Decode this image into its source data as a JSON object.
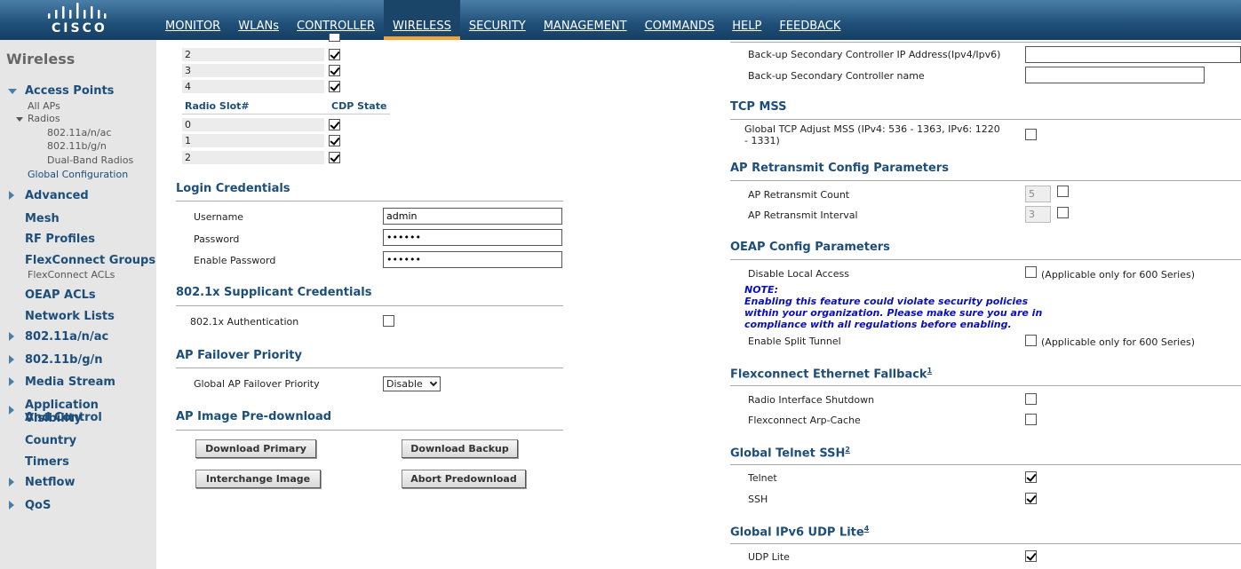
{
  "brand": {
    "logo_text": "CISCO"
  },
  "nav": [
    {
      "label": "MONITOR"
    },
    {
      "label": "WLANs"
    },
    {
      "label": "CONTROLLER"
    },
    {
      "label": "WIRELESS"
    },
    {
      "label": "SECURITY"
    },
    {
      "label": "MANAGEMENT"
    },
    {
      "label": "COMMANDS"
    },
    {
      "label": "HELP"
    },
    {
      "label": "FEEDBACK"
    }
  ],
  "sidebar": {
    "title": "Wireless",
    "access_points": "Access Points",
    "all_aps": "All APs",
    "radios": "Radios",
    "radio_a": "802.11a/n/ac",
    "radio_b": "802.11b/g/n",
    "dual_band": "Dual-Band Radios",
    "global_config": "Global Configuration",
    "advanced": "Advanced",
    "mesh": "Mesh",
    "rf_profiles": "RF Profiles",
    "flexconnect_groups": "FlexConnect Groups",
    "flexconnect_acls": "FlexConnect ACLs",
    "oeap_acls": "OEAP ACLs",
    "network_lists": "Network Lists",
    "a_n_ac": "802.11a/n/ac",
    "b_g_n": "802.11b/g/n",
    "media_stream": "Media Stream",
    "avc_line1": "Application Visibility",
    "avc_line2": "And Control",
    "country": "Country",
    "timers": "Timers",
    "netflow": "Netflow",
    "qos": "QoS"
  },
  "left": {
    "upper_slots": [
      "2",
      "3",
      "4"
    ],
    "radio_slot_header": "Radio Slot#",
    "cdp_state_header": "CDP State",
    "radio_slots": [
      "0",
      "1",
      "2"
    ],
    "login_credentials": "Login Credentials",
    "username_label": "Username",
    "username_value": "admin",
    "password_label": "Password",
    "password_value": "••••••",
    "enable_password_label": "Enable Password",
    "enable_password_value": "••••••",
    "supplicant_title": "802.1x Supplicant Credentials",
    "dot1x_auth_label": "802.1x Authentication",
    "failover_title": "AP Failover Priority",
    "failover_label": "Global AP Failover Priority",
    "failover_value": "Disable",
    "predownload_title": "AP Image Pre-download",
    "download_primary": "Download Primary",
    "download_backup": "Download Backup",
    "interchange_image": "Interchange Image",
    "abort_predownload": "Abort Predownload"
  },
  "right": {
    "backup_secondary_ip_label": "Back-up Secondary Controller IP Address(Ipv4/Ipv6)",
    "backup_secondary_name_label": "Back-up Secondary Controller name",
    "tcp_mss_title": "TCP MSS",
    "tcp_mss_label_1": "Global TCP Adjust MSS (IPv4: 536 - 1363, IPv6: 1220",
    "tcp_mss_label_2": "- 1331)",
    "retransmit_title": "AP Retransmit Config Parameters",
    "retransmit_count_label": "AP Retransmit Count",
    "retransmit_count_value": "5",
    "retransmit_interval_label": "AP Retransmit Interval",
    "retransmit_interval_value": "3",
    "oeap_title": "OEAP Config Parameters",
    "disable_local_access_label": "Disable Local Access",
    "applicable_600": "(Applicable only for 600 Series)",
    "note_title": "NOTE:",
    "note_line1": "Enabling this feature could violate security policies",
    "note_line2": "within your organization. Please make sure you are in",
    "note_line3": "compliance with all regulations before enabling.",
    "split_tunnel_label": "Enable Split Tunnel",
    "fallback_title": "Flexconnect Ethernet Fallback",
    "fallback_sup": "1",
    "radio_shutdown_label": "Radio Interface Shutdown",
    "arp_cache_label": "Flexconnect Arp-Cache",
    "telnet_ssh_title": "Global Telnet SSH",
    "telnet_ssh_sup": "2",
    "telnet_label": "Telnet",
    "ssh_label": "SSH",
    "udp_lite_title": "Global IPv6 UDP Lite",
    "udp_lite_sup": "4",
    "udp_lite_label": "UDP Lite"
  },
  "colors": {
    "accent": "#1d4e7a",
    "nav_bg": "#1f4f78",
    "active_underline": "#f0a43a",
    "note": "#0a10b8"
  }
}
